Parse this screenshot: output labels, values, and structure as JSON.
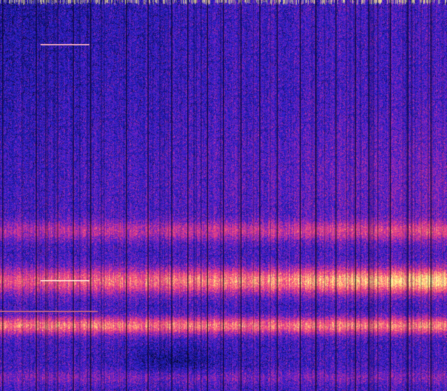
{
  "image": {
    "kind": "spectrogram waterfall",
    "colormap": [
      "#000000",
      "#10106e",
      "#2020c8",
      "#6a1ec8",
      "#c0309e",
      "#f0407a",
      "#ff8080",
      "#ffe070",
      "#ffffb0"
    ],
    "background_color": "#1a0a6e"
  }
}
